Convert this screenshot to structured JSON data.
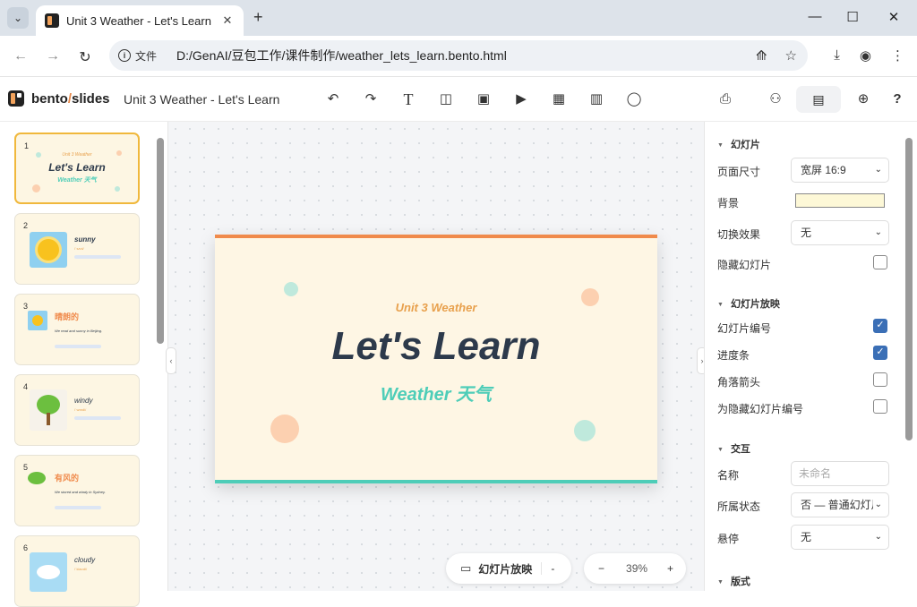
{
  "browser": {
    "tab_title": "Unit 3 Weather - Let's Learn",
    "info_label": "文件",
    "url": "D:/GenAI/豆包工作/课件制作/weather_lets_learn.bento.html"
  },
  "app": {
    "logo_main": "bento",
    "logo_sep": "/",
    "logo_sub": "slides",
    "doc_title": "Unit 3 Weather - Let's Learn"
  },
  "thumbnails": [
    {
      "num": "1",
      "small": "Unit 3 Weather",
      "title": "Let's Learn",
      "sub": "Weather 天气"
    },
    {
      "num": "2",
      "title": "sunny",
      "sub": "/ˈsʌni/"
    },
    {
      "num": "3",
      "title": "晴朗的",
      "line": "We read and sunny in Beijing."
    },
    {
      "num": "4",
      "title": "windy",
      "sub": "/ˈwɪndi/"
    },
    {
      "num": "5",
      "title": "有风的",
      "line": "We stored and windy in Sydney."
    },
    {
      "num": "6",
      "title": "cloudy",
      "sub": "/ˈklaʊdi/"
    }
  ],
  "slide": {
    "unit": "Unit 3 Weather",
    "title": "Let's Learn",
    "subtitle": "Weather 天气"
  },
  "bottom": {
    "present_label": "幻灯片放映",
    "more": "-",
    "zoom_minus": "−",
    "zoom": "39%",
    "zoom_plus": "+"
  },
  "props": {
    "sec_slide": "幻灯片",
    "page_size_label": "页面尺寸",
    "page_size_value": "宽屏 16:9",
    "bg_label": "背景",
    "transition_label": "切换效果",
    "transition_value": "无",
    "hide_label": "隐藏幻灯片",
    "sec_show": "幻灯片放映",
    "num_label": "幻灯片编号",
    "progress_label": "进度条",
    "arrows_label": "角落箭头",
    "hidden_num_label": "为隐藏幻灯片编号",
    "sec_interact": "交互",
    "name_label": "名称",
    "name_placeholder": "未命名",
    "state_label": "所属状态",
    "state_value": "否 — 普通幻灯片",
    "hover_label": "悬停",
    "hover_value": "无",
    "sec_layout": "版式"
  },
  "colors": {
    "slide_bg": "#fef6e4",
    "accent_orange": "#f08a4b",
    "accent_teal": "#4ecdb8",
    "title_dark": "#2d3a4b",
    "checkbox_on": "#3b6fb6"
  }
}
